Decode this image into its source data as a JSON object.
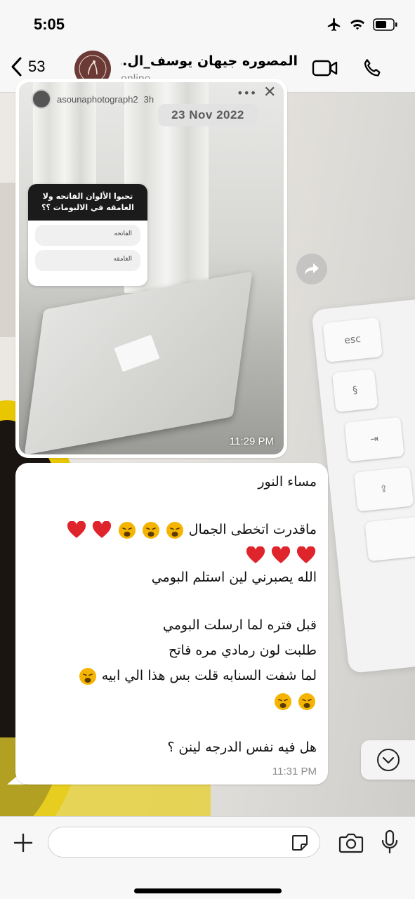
{
  "status_bar": {
    "time": "5:05"
  },
  "header": {
    "back_count": "53",
    "contact_name": "المصوره جيهان يوسف_ال...",
    "contact_status": "online"
  },
  "chat": {
    "date_chip": "23 Nov 2022",
    "image_message": {
      "story_username": "asounaphotograph2",
      "story_age": "3h",
      "poll_question": "تحبوا الألوان الفاتحه ولا الغامقه في الالبومات ؟؟",
      "poll_option_1": "الفاتحه",
      "poll_option_2": "الغامقه",
      "time": "11:29 PM"
    },
    "text_message": {
      "line1": "مساء النور",
      "line2": "ماقدرت اتخطى الجمال",
      "line4": "الله يصبرني لين استلم البومي",
      "line5": "قبل فتره لما ارسلت البومي",
      "line6": "طلبت لون رمادي مره فاتح",
      "line7": "لما شفت السنابه قلت بس هذا الي ابيه",
      "line9": "هل فيه نفس الدرجه لينن ؟",
      "time": "11:31 PM"
    }
  },
  "composer": {
    "placeholder": ""
  },
  "colors": {
    "accent": "#007aff",
    "heart": "#e0242b",
    "emoji_face": "#f4b400"
  }
}
